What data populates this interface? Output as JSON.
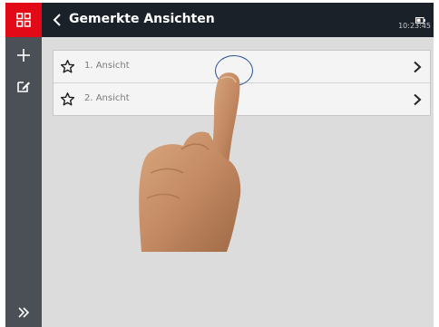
{
  "colors": {
    "accent": "#e20a17",
    "topbar": "#1b2129",
    "sidebar": "#4a5056",
    "content_bg": "#dddcdd",
    "touch_ring": "#2b4f95"
  },
  "sidebar": {
    "apps_icon": "grid-icon",
    "add_icon": "plus-icon",
    "edit_icon": "edit-icon",
    "expand_icon": "double-chevron-right-icon"
  },
  "header": {
    "back_icon": "chevron-left-icon",
    "title": "Gemerkte Ansichten",
    "battery_icon": "battery-icon",
    "time": "10:23:45"
  },
  "views": [
    {
      "icon": "star-outline-icon",
      "label": "1. Ansicht",
      "action_icon": "chevron-right-icon"
    },
    {
      "icon": "star-outline-icon",
      "label": "2. Ansicht",
      "action_icon": "chevron-right-icon"
    }
  ]
}
